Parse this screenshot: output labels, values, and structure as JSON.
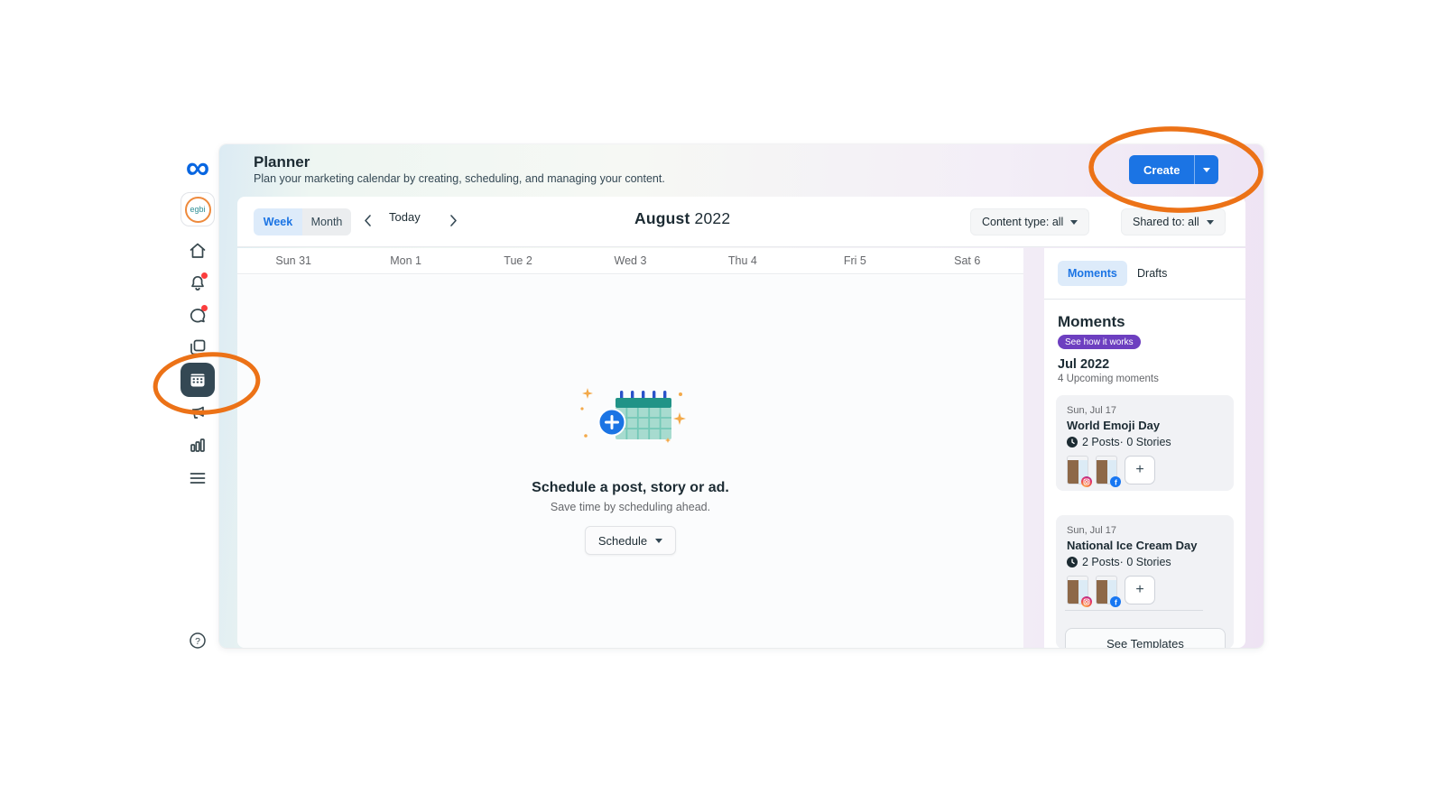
{
  "colors": {
    "accent": "#1b74e4",
    "accent_light": "#ddebfa",
    "badge_purple": "#6d3fc0",
    "selected_tile": "#344854",
    "red_dot": "#fb3d3d",
    "annotation_orange": "#ec7217",
    "illus_teal_header": "#219387",
    "illus_teal_body": "#a7dbcf"
  },
  "sidebar": {
    "avatar_label": "egbi",
    "icons": [
      "meta-logo",
      "home",
      "notifications",
      "messages",
      "posts",
      "planner",
      "ads",
      "insights",
      "menu",
      "help"
    ],
    "selected": "planner"
  },
  "header": {
    "title": "Planner",
    "subtitle": "Plan your marketing calendar by creating, scheduling, and managing your content.",
    "create_label": "Create"
  },
  "toolbar": {
    "week_label": "Week",
    "month_label": "Month",
    "today_label": "Today",
    "month_title": "August",
    "year_title": "2022",
    "content_type_label": "Content type: all",
    "shared_to_label": "Shared to: all"
  },
  "calendar": {
    "days": [
      "Sun 31",
      "Mon 1",
      "Tue 2",
      "Wed 3",
      "Thu 4",
      "Fri 5",
      "Sat 6"
    ],
    "empty": {
      "title": "Schedule a post, story or ad.",
      "subtitle": "Save time by scheduling ahead.",
      "button_label": "Schedule"
    }
  },
  "panel": {
    "tab_moments": "Moments",
    "tab_drafts": "Drafts",
    "heading": "Moments",
    "badge": "See how it works",
    "period": "Jul 2022",
    "upcoming": "4 Upcoming moments",
    "add_label": "+",
    "see_templates_label": "See Templates",
    "moments": [
      {
        "date": "Sun, Jul 17",
        "title": "World Emoji Day",
        "stats": "2 Posts· 0 Stories",
        "platforms": [
          "instagram",
          "facebook"
        ]
      },
      {
        "date": "Sun, Jul 17",
        "title": "National Ice Cream Day",
        "stats": "2 Posts· 0 Stories",
        "platforms": [
          "instagram",
          "facebook"
        ]
      }
    ]
  }
}
